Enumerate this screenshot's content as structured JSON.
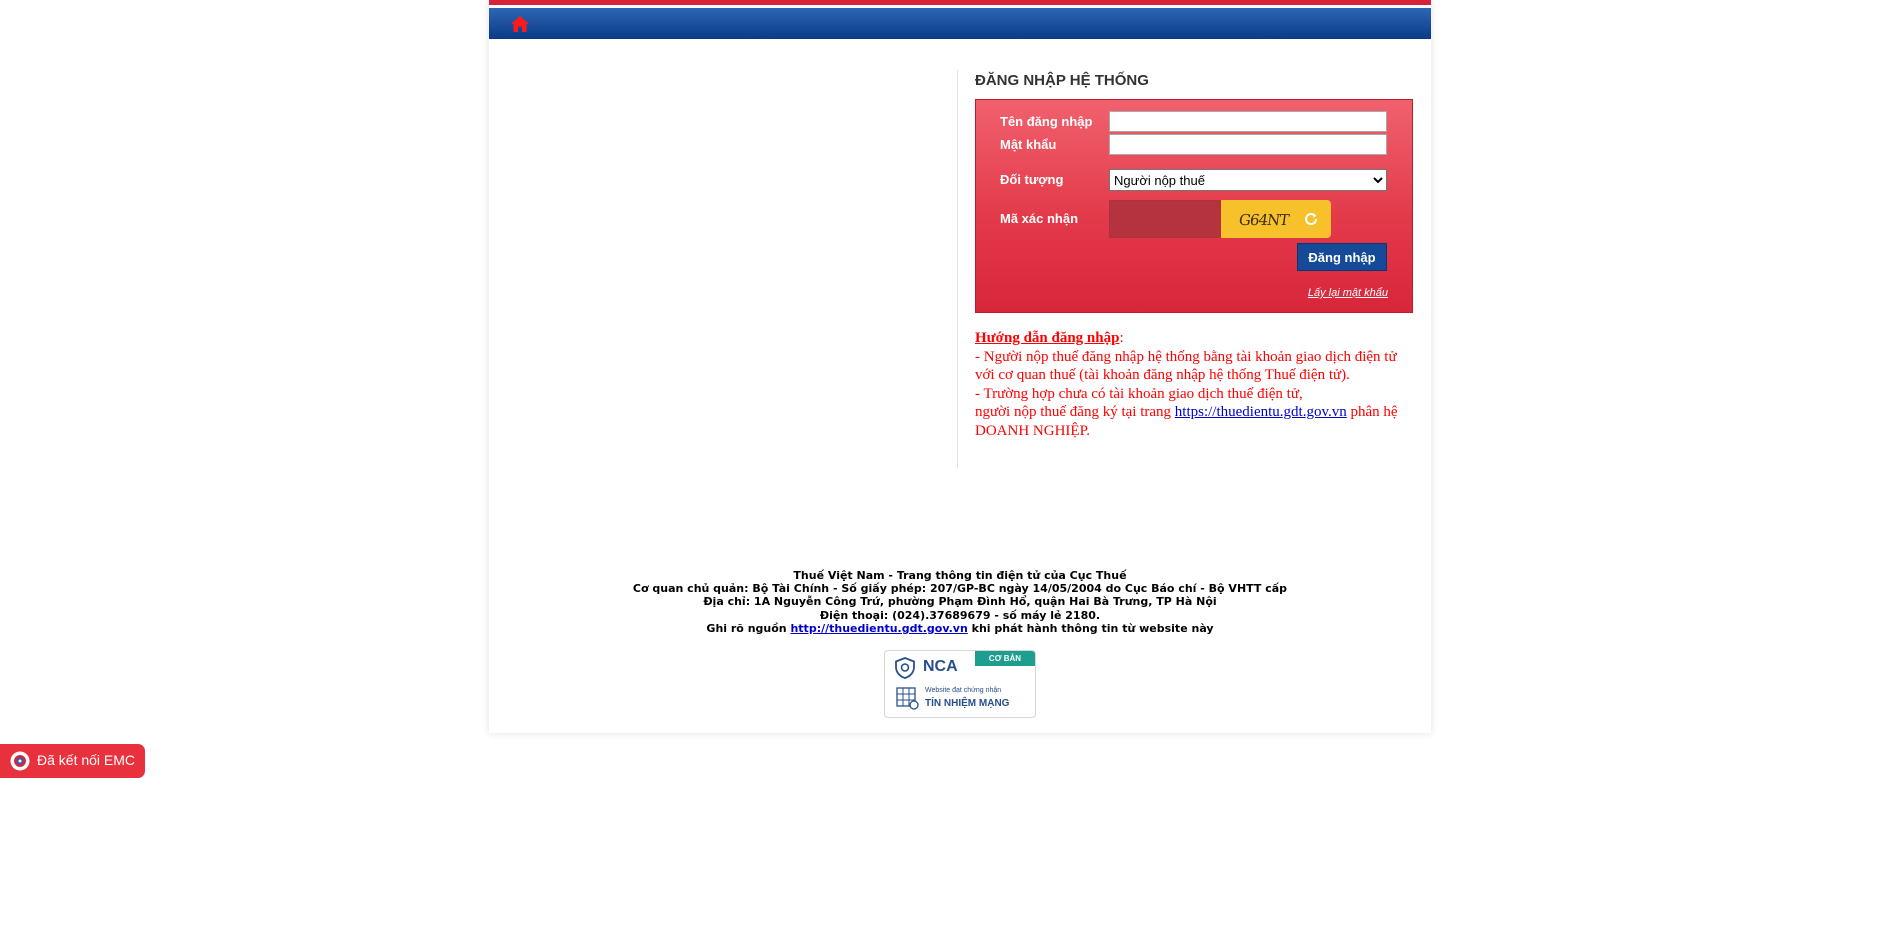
{
  "login": {
    "title": "ĐĂNG NHẬP HỆ THỐNG",
    "username_label": "Tên đăng nhập",
    "username_value": "",
    "password_label": "Mật khẩu",
    "password_value": "",
    "role_label": "Đối tượng",
    "role_selected": "Người nộp thuế",
    "captcha_label": "Mã xác nhận",
    "captcha_value": "",
    "captcha_text": "G64NT",
    "submit_label": "Đăng nhập",
    "forgot_label": "Lấy lại mật khẩu"
  },
  "guide": {
    "title": "Hướng dẫn đăng nhập",
    "line1": "- Người nộp thuế đăng nhập hệ thống bằng tài khoản giao dịch điện tử với cơ quan thuế (tài khoản đăng nhập hệ thống Thuế điện tử).",
    "line2": "- Trường hợp chưa có tài khoản giao dịch thuế điện tử,",
    "line3_before": "người nộp thuế đăng ký tại trang",
    "link": "https://thuedientu.gdt.gov.vn",
    "line3_after": "phân hệ DOANH NGHIỆP."
  },
  "footer": {
    "line1": "Thuế Việt Nam - Trang thông tin điện tử của Cục Thuế",
    "line2": "Cơ quan chủ quản: Bộ Tài Chính - Số giấy phép: 207/GP-BC ngày 14/05/2004 do Cục Báo chí - Bộ VHTT cấp",
    "line3": "Địa chỉ: 1A Nguyễn Công Trứ, phường Phạm Đình Hổ, quận Hai Bà Trưng, TP Hà Nội",
    "line4": "Điện thoại: (024).37689679 - số máy lẻ 2180.",
    "line5_before": "Ghi rõ nguồn",
    "line5_link": "http://thuedientu.gdt.gov.vn",
    "line5_after": "khi phát hành thông tin từ website này"
  },
  "nca_badge": {
    "logo": "NCA",
    "level": "CƠ BẢN",
    "small_text": "Website đạt chứng nhận",
    "big_text": "TÍN NHIỆM MẠNG"
  },
  "emc": {
    "label": "Đã kết nối EMC"
  },
  "icons": {
    "home": "home-icon",
    "refresh": "refresh-icon",
    "shield": "shield-icon",
    "emc": "emc-icon"
  },
  "colors": {
    "navbar": "#0a3a88",
    "top_stripe": "#d8243a",
    "login_box": "#e33a4a",
    "login_button": "#144a98",
    "guide_text": "#ff0000",
    "emc_badge": "#e8313c"
  }
}
